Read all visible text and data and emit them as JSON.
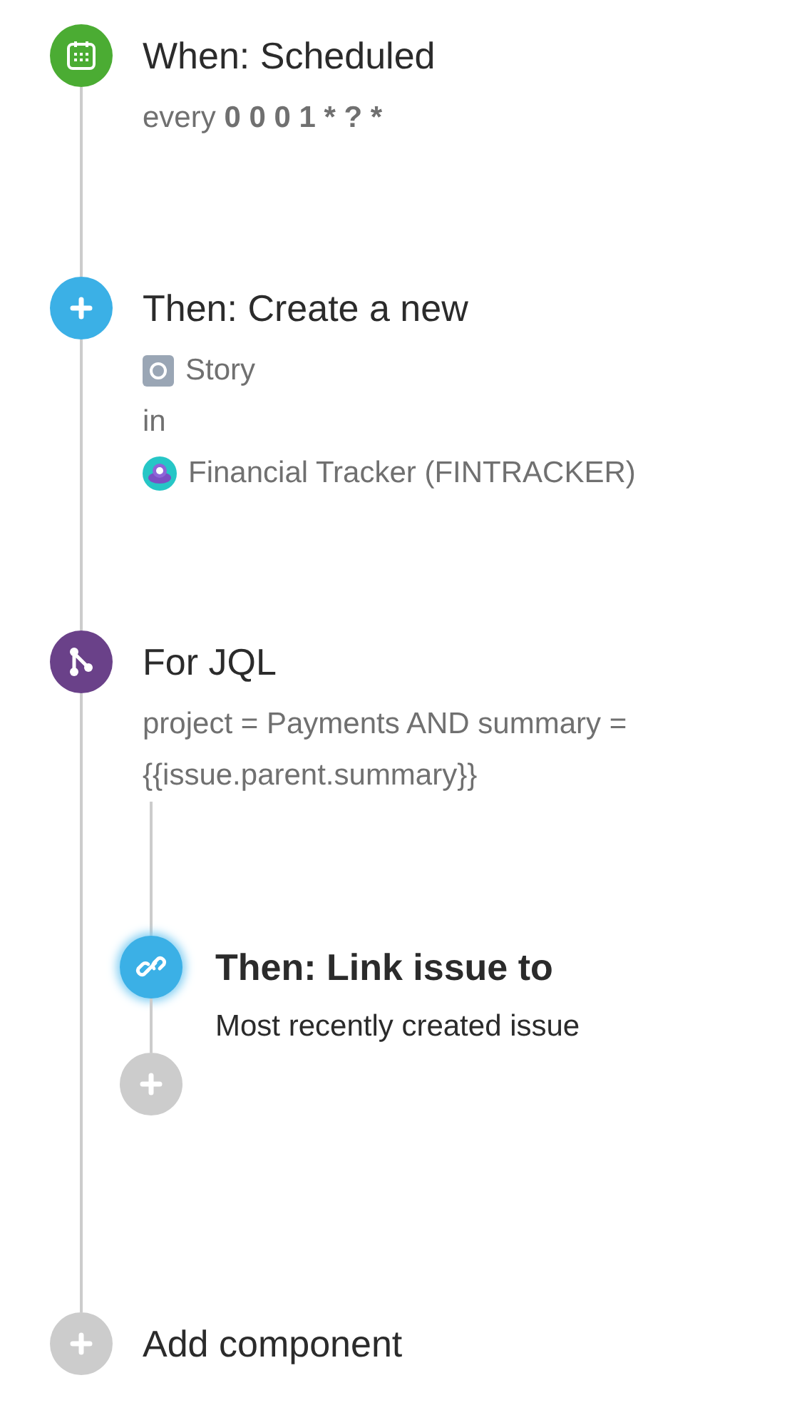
{
  "steps": [
    {
      "kind": "trigger",
      "selected": false,
      "title": "When: Scheduled",
      "schedule": {
        "prefix": "every",
        "expression": "0 0 0 1 * ? *"
      }
    },
    {
      "kind": "create",
      "selected": false,
      "title": "Then: Create a new",
      "issue_type": "Story",
      "connector": "in",
      "project": "Financial Tracker (FINTRACKER)"
    },
    {
      "kind": "branch",
      "selected": false,
      "title": "For JQL",
      "query": "project = Payments AND summary = {{issue.parent.summary}}",
      "children": [
        {
          "kind": "link",
          "selected": true,
          "title": "Then: Link issue to",
          "detail": "Most recently created issue"
        },
        {
          "kind": "add",
          "selected": false
        }
      ]
    },
    {
      "kind": "add",
      "selected": false,
      "title": "Add component"
    }
  ]
}
